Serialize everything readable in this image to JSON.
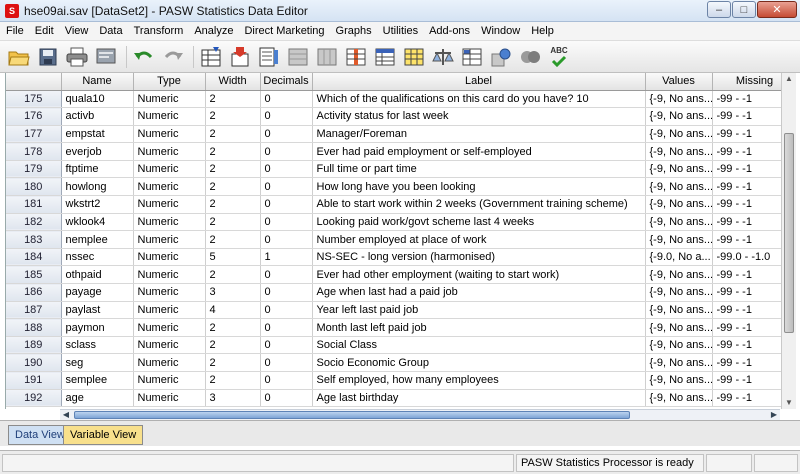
{
  "window": {
    "title": "hse09ai.sav [DataSet2] - PASW Statistics Data Editor",
    "app_icon_letter": "S"
  },
  "menu": [
    "File",
    "Edit",
    "View",
    "Data",
    "Transform",
    "Analyze",
    "Direct Marketing",
    "Graphs",
    "Utilities",
    "Add-ons",
    "Window",
    "Help"
  ],
  "toolbar": {
    "icons": [
      "open-icon",
      "save-icon",
      "print-icon",
      "dialog-recall-icon",
      "undo-icon",
      "redo-icon",
      "goto-case-icon",
      "goto-variable-icon",
      "variables-icon",
      "find-icon",
      "insert-cases-icon",
      "insert-variable-icon",
      "split-file-icon",
      "weight-cases-icon",
      "select-cases-icon",
      "value-labels-icon",
      "use-sets-icon",
      "show-all-variables-icon",
      "spell-check-icon"
    ],
    "spell_label": "ABC"
  },
  "grid": {
    "columns": [
      "",
      "Name",
      "Type",
      "Width",
      "Decimals",
      "Label",
      "Values",
      "Missing"
    ],
    "rows": [
      {
        "num": "175",
        "name": "quala10",
        "type": "Numeric",
        "width": "2",
        "decimals": "0",
        "label": "Which of the qualifications on this card do you have? 10",
        "values": "{-9, No ans...",
        "missing": "-99 - -1"
      },
      {
        "num": "176",
        "name": "activb",
        "type": "Numeric",
        "width": "2",
        "decimals": "0",
        "label": "Activity status for last week",
        "values": "{-9, No ans...",
        "missing": "-99 - -1"
      },
      {
        "num": "177",
        "name": "empstat",
        "type": "Numeric",
        "width": "2",
        "decimals": "0",
        "label": "Manager/Foreman",
        "values": "{-9, No ans...",
        "missing": "-99 - -1"
      },
      {
        "num": "178",
        "name": "everjob",
        "type": "Numeric",
        "width": "2",
        "decimals": "0",
        "label": "Ever had paid employment or self-employed",
        "values": "{-9, No ans...",
        "missing": "-99 - -1"
      },
      {
        "num": "179",
        "name": "ftptime",
        "type": "Numeric",
        "width": "2",
        "decimals": "0",
        "label": "Full time or part time",
        "values": "{-9, No ans...",
        "missing": "-99 - -1"
      },
      {
        "num": "180",
        "name": "howlong",
        "type": "Numeric",
        "width": "2",
        "decimals": "0",
        "label": "How long have you been looking",
        "values": "{-9, No ans...",
        "missing": "-99 - -1"
      },
      {
        "num": "181",
        "name": "wkstrt2",
        "type": "Numeric",
        "width": "2",
        "decimals": "0",
        "label": "Able to start work within 2 weeks (Government training scheme)",
        "values": "{-9, No ans...",
        "missing": "-99 - -1"
      },
      {
        "num": "182",
        "name": "wklook4",
        "type": "Numeric",
        "width": "2",
        "decimals": "0",
        "label": "Looking paid work/govt scheme last 4 weeks",
        "values": "{-9, No ans...",
        "missing": "-99 - -1"
      },
      {
        "num": "183",
        "name": "nemplee",
        "type": "Numeric",
        "width": "2",
        "decimals": "0",
        "label": "Number employed at place of work",
        "values": "{-9, No ans...",
        "missing": "-99 - -1"
      },
      {
        "num": "184",
        "name": "nssec",
        "type": "Numeric",
        "width": "5",
        "decimals": "1",
        "label": "NS-SEC - long version (harmonised)",
        "values": "{-9.0, No a...",
        "missing": "-99.0 - -1.0"
      },
      {
        "num": "185",
        "name": "othpaid",
        "type": "Numeric",
        "width": "2",
        "decimals": "0",
        "label": "Ever had other employment (waiting to start work)",
        "values": "{-9, No ans...",
        "missing": "-99 - -1"
      },
      {
        "num": "186",
        "name": "payage",
        "type": "Numeric",
        "width": "3",
        "decimals": "0",
        "label": "Age when last had a paid job",
        "values": "{-9, No ans...",
        "missing": "-99 - -1"
      },
      {
        "num": "187",
        "name": "paylast",
        "type": "Numeric",
        "width": "4",
        "decimals": "0",
        "label": "Year left last paid job",
        "values": "{-9, No ans...",
        "missing": "-99 - -1"
      },
      {
        "num": "188",
        "name": "paymon",
        "type": "Numeric",
        "width": "2",
        "decimals": "0",
        "label": "Month last left paid job",
        "values": "{-9, No ans...",
        "missing": "-99 - -1"
      },
      {
        "num": "189",
        "name": "sclass",
        "type": "Numeric",
        "width": "2",
        "decimals": "0",
        "label": "Social Class",
        "values": "{-9, No ans...",
        "missing": "-99 - -1"
      },
      {
        "num": "190",
        "name": "seg",
        "type": "Numeric",
        "width": "2",
        "decimals": "0",
        "label": "Socio Economic Group",
        "values": "{-9, No ans...",
        "missing": "-99 - -1"
      },
      {
        "num": "191",
        "name": "semplee",
        "type": "Numeric",
        "width": "2",
        "decimals": "0",
        "label": "Self employed, how many employees",
        "values": "{-9, No ans...",
        "missing": "-99 - -1"
      },
      {
        "num": "192",
        "name": "age",
        "type": "Numeric",
        "width": "3",
        "decimals": "0",
        "label": "Age last birthday",
        "values": "{-9, No ans...",
        "missing": "-99 - -1"
      }
    ]
  },
  "tabs": {
    "data_view": "Data View",
    "variable_view": "Variable View",
    "active": "variable_view"
  },
  "status": {
    "processor": "PASW Statistics Processor is ready"
  },
  "colors": {
    "active_tab": "#f8e08c",
    "inactive_tab": "#cfe0f3"
  }
}
